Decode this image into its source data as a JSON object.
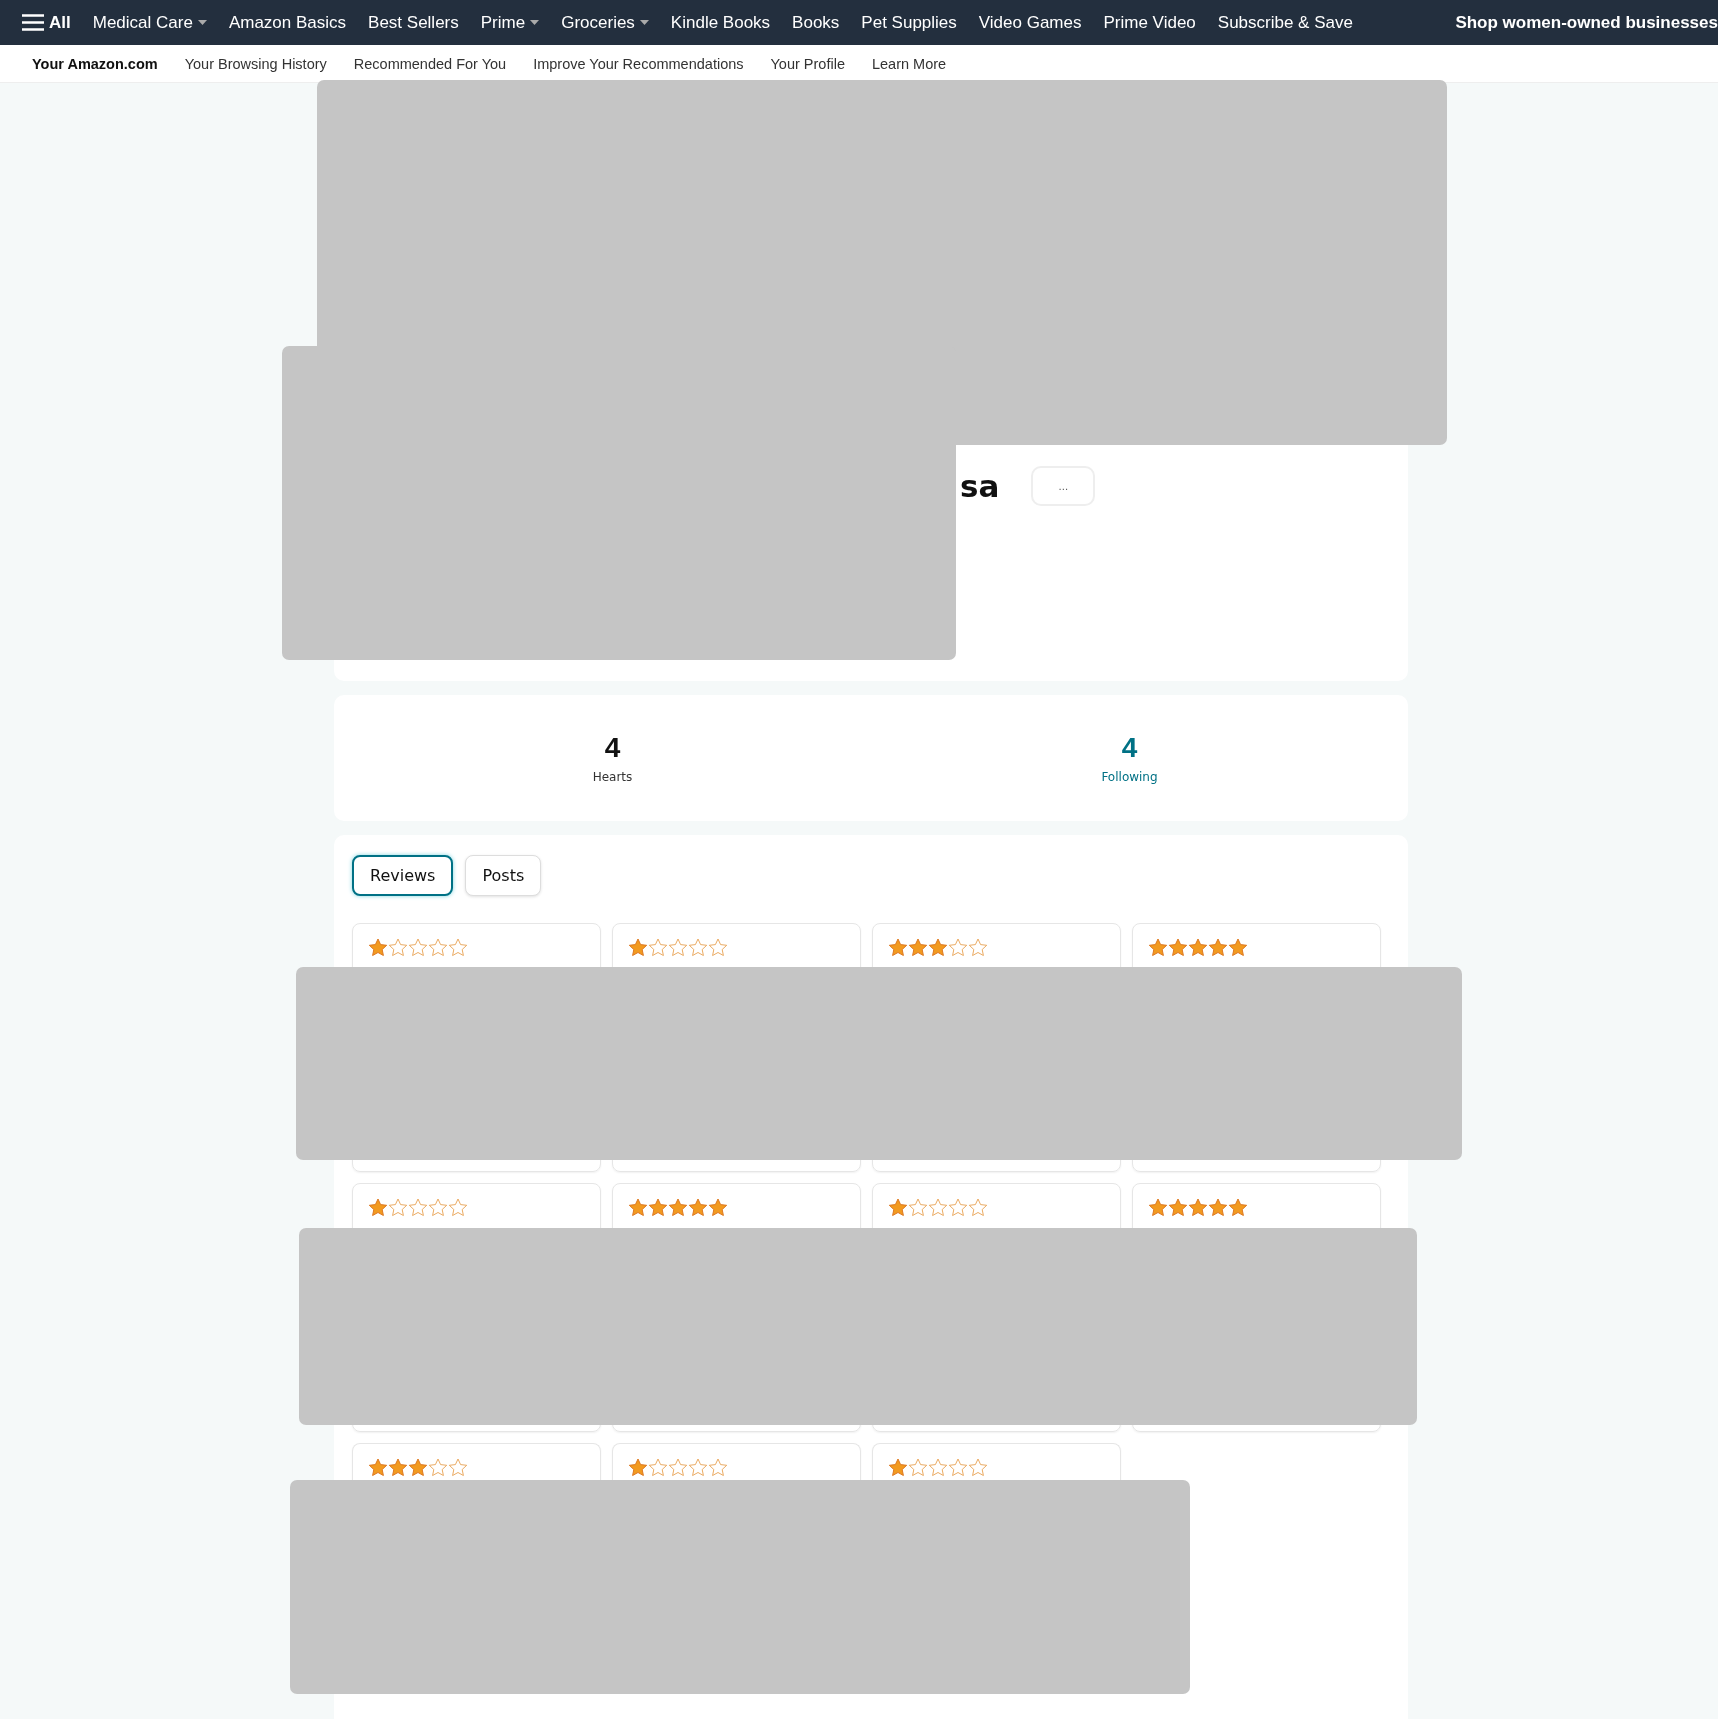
{
  "nav": {
    "all_label": "All",
    "items": [
      {
        "label": "Medical Care",
        "kind": "menu"
      },
      {
        "label": "Amazon Basics",
        "kind": "link"
      },
      {
        "label": "Best Sellers",
        "kind": "link"
      },
      {
        "label": "Prime",
        "kind": "menu"
      },
      {
        "label": "Groceries",
        "kind": "menu"
      },
      {
        "label": "Kindle Books",
        "kind": "link"
      },
      {
        "label": "Books",
        "kind": "link"
      },
      {
        "label": "Pet Supplies",
        "kind": "link"
      },
      {
        "label": "Video Games",
        "kind": "link"
      },
      {
        "label": "Prime Video",
        "kind": "link"
      },
      {
        "label": "Subscribe & Save",
        "kind": "link"
      },
      {
        "label": "Shop women-owned businesses",
        "kind": "promo"
      }
    ]
  },
  "subnav": [
    {
      "label": "Your Amazon.com",
      "selected": true
    },
    {
      "label": "Your Browsing History",
      "selected": false
    },
    {
      "label": "Recommended For You",
      "selected": false
    },
    {
      "label": "Improve Your Recommendations",
      "selected": false
    },
    {
      "label": "Your Profile",
      "selected": false
    },
    {
      "label": "Learn More",
      "selected": false
    }
  ],
  "profile": {
    "name": "sa",
    "more_button": "..."
  },
  "stats": [
    {
      "value": "4",
      "label": "Hearts",
      "kind": "plain"
    },
    {
      "value": "4",
      "label": "Following",
      "kind": "link"
    }
  ],
  "tabs": [
    {
      "label": "Reviews",
      "selected": true
    },
    {
      "label": "Posts",
      "selected": false
    }
  ],
  "reviews": [
    {
      "stars": 1
    },
    {
      "stars": 1
    },
    {
      "stars": 3
    },
    {
      "stars": 5
    },
    {
      "stars": 1
    },
    {
      "stars": 5
    },
    {
      "stars": 1
    },
    {
      "stars": 5
    },
    {
      "stars": 3
    },
    {
      "stars": 1
    },
    {
      "stars": 1
    }
  ]
}
